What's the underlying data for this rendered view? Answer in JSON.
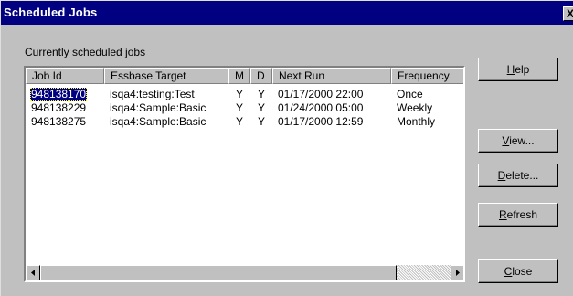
{
  "window": {
    "title": "Scheduled Jobs",
    "close_label": "X"
  },
  "caption": "Currently scheduled jobs",
  "table": {
    "columns": [
      "Job Id",
      "Essbase Target",
      "M",
      "D",
      "Next Run",
      "Frequency"
    ],
    "rows": [
      [
        "948138170",
        "isqa4:testing:Test",
        "Y",
        "Y",
        "01/17/2000 22:00",
        "Once"
      ],
      [
        "948138229",
        "isqa4:Sample:Basic",
        "Y",
        "Y",
        "01/24/2000 05:00",
        "Weekly"
      ],
      [
        "948138275",
        "isqa4:Sample:Basic",
        "Y",
        "Y",
        "01/17/2000 12:59",
        "Monthly"
      ]
    ],
    "selected_row": 0
  },
  "buttons": {
    "help": {
      "mnemonic": "H",
      "rest": "elp"
    },
    "view": {
      "mnemonic": "V",
      "rest": "iew..."
    },
    "delete": {
      "mnemonic": "D",
      "rest": "elete..."
    },
    "refresh": {
      "mnemonic": "R",
      "rest": "efresh"
    },
    "close": {
      "mnemonic": "C",
      "rest": "lose"
    }
  },
  "icons": {
    "scroll_left": "arrow-left-icon",
    "scroll_right": "arrow-right-icon"
  }
}
